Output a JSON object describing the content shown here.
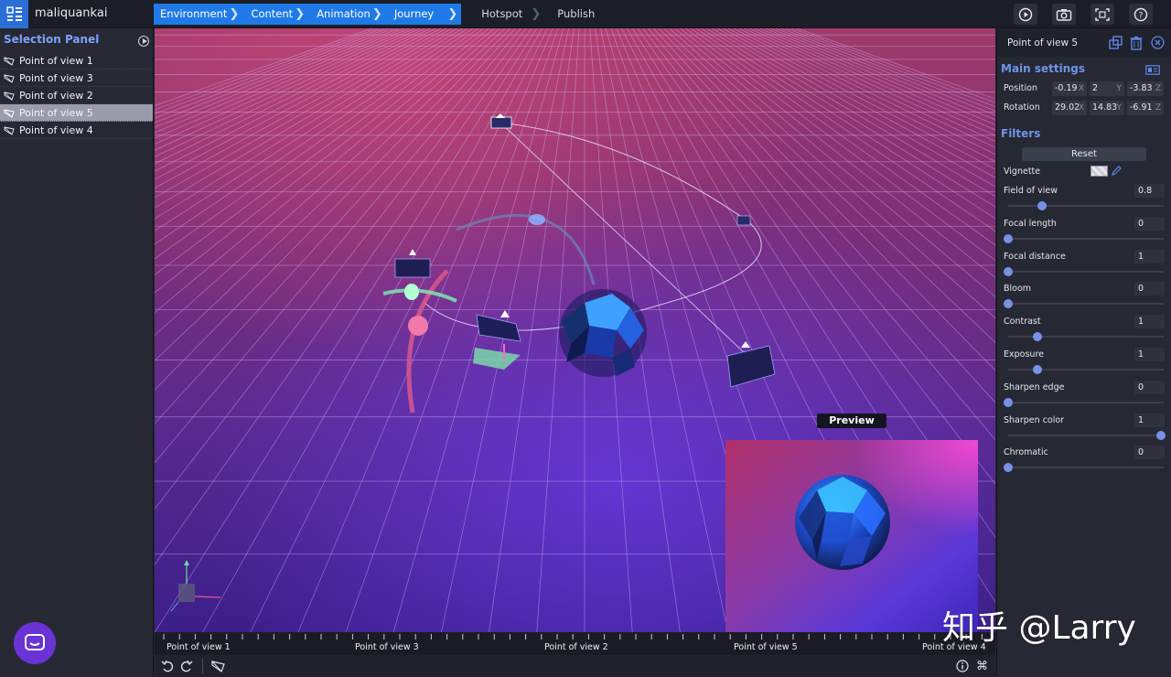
{
  "app": {
    "name": "maliquankai"
  },
  "breadcrumb": [
    {
      "label": "Environment",
      "active": true
    },
    {
      "label": "Content",
      "active": true
    },
    {
      "label": "Animation",
      "active": true
    },
    {
      "label": "Journey",
      "active": true
    },
    {
      "label": "Hotspot",
      "active": false
    },
    {
      "label": "Publish",
      "active": false
    }
  ],
  "toolbar": {
    "icons": [
      "play-icon",
      "camera-icon",
      "frame-icon",
      "help-icon"
    ]
  },
  "selection_panel": {
    "title": "Selection Panel",
    "items": [
      {
        "label": "Point of view 1",
        "selected": false
      },
      {
        "label": "Point of view 3",
        "selected": false
      },
      {
        "label": "Point of view 2",
        "selected": false
      },
      {
        "label": "Point of view 5",
        "selected": true
      },
      {
        "label": "Point of view 4",
        "selected": false
      }
    ]
  },
  "viewport": {
    "preview_label": "Preview"
  },
  "timeline": {
    "labels": [
      "Point of view 1",
      "Point of view 3",
      "Point of view 2",
      "Point of view 5",
      "Point of view 4"
    ]
  },
  "properties": {
    "title": "Point of view 5",
    "main_settings": {
      "title": "Main settings",
      "position_label": "Position",
      "position": {
        "x": "-0.19",
        "y": "2",
        "z": "-3.83"
      },
      "rotation_label": "Rotation",
      "rotation": {
        "x": "29.02",
        "y": "14.83",
        "z": "-6.91"
      },
      "axis_x": "X",
      "axis_y": "Y",
      "axis_z": "Z"
    },
    "filters": {
      "title": "Filters",
      "reset_label": "Reset",
      "vignette_label": "Vignette",
      "sliders": [
        {
          "label": "Field of view",
          "value": "0.8",
          "fraction": 0.22
        },
        {
          "label": "Focal length",
          "value": "0",
          "fraction": 0.0
        },
        {
          "label": "Focal distance",
          "value": "1",
          "fraction": 0.0
        },
        {
          "label": "Bloom",
          "value": "0",
          "fraction": 0.0
        },
        {
          "label": "Contrast",
          "value": "1",
          "fraction": 0.19
        },
        {
          "label": "Exposure",
          "value": "1",
          "fraction": 0.19
        },
        {
          "label": "Sharpen edge",
          "value": "0",
          "fraction": 0.0
        },
        {
          "label": "Sharpen color",
          "value": "1",
          "fraction": 0.98
        },
        {
          "label": "Chromatic",
          "value": "0",
          "fraction": 0.0
        }
      ]
    }
  },
  "watermark": "知乎 @Larry",
  "colors": {
    "accent": "#1f7ae8",
    "section": "#6f95ea",
    "slider": "#7890e8"
  }
}
